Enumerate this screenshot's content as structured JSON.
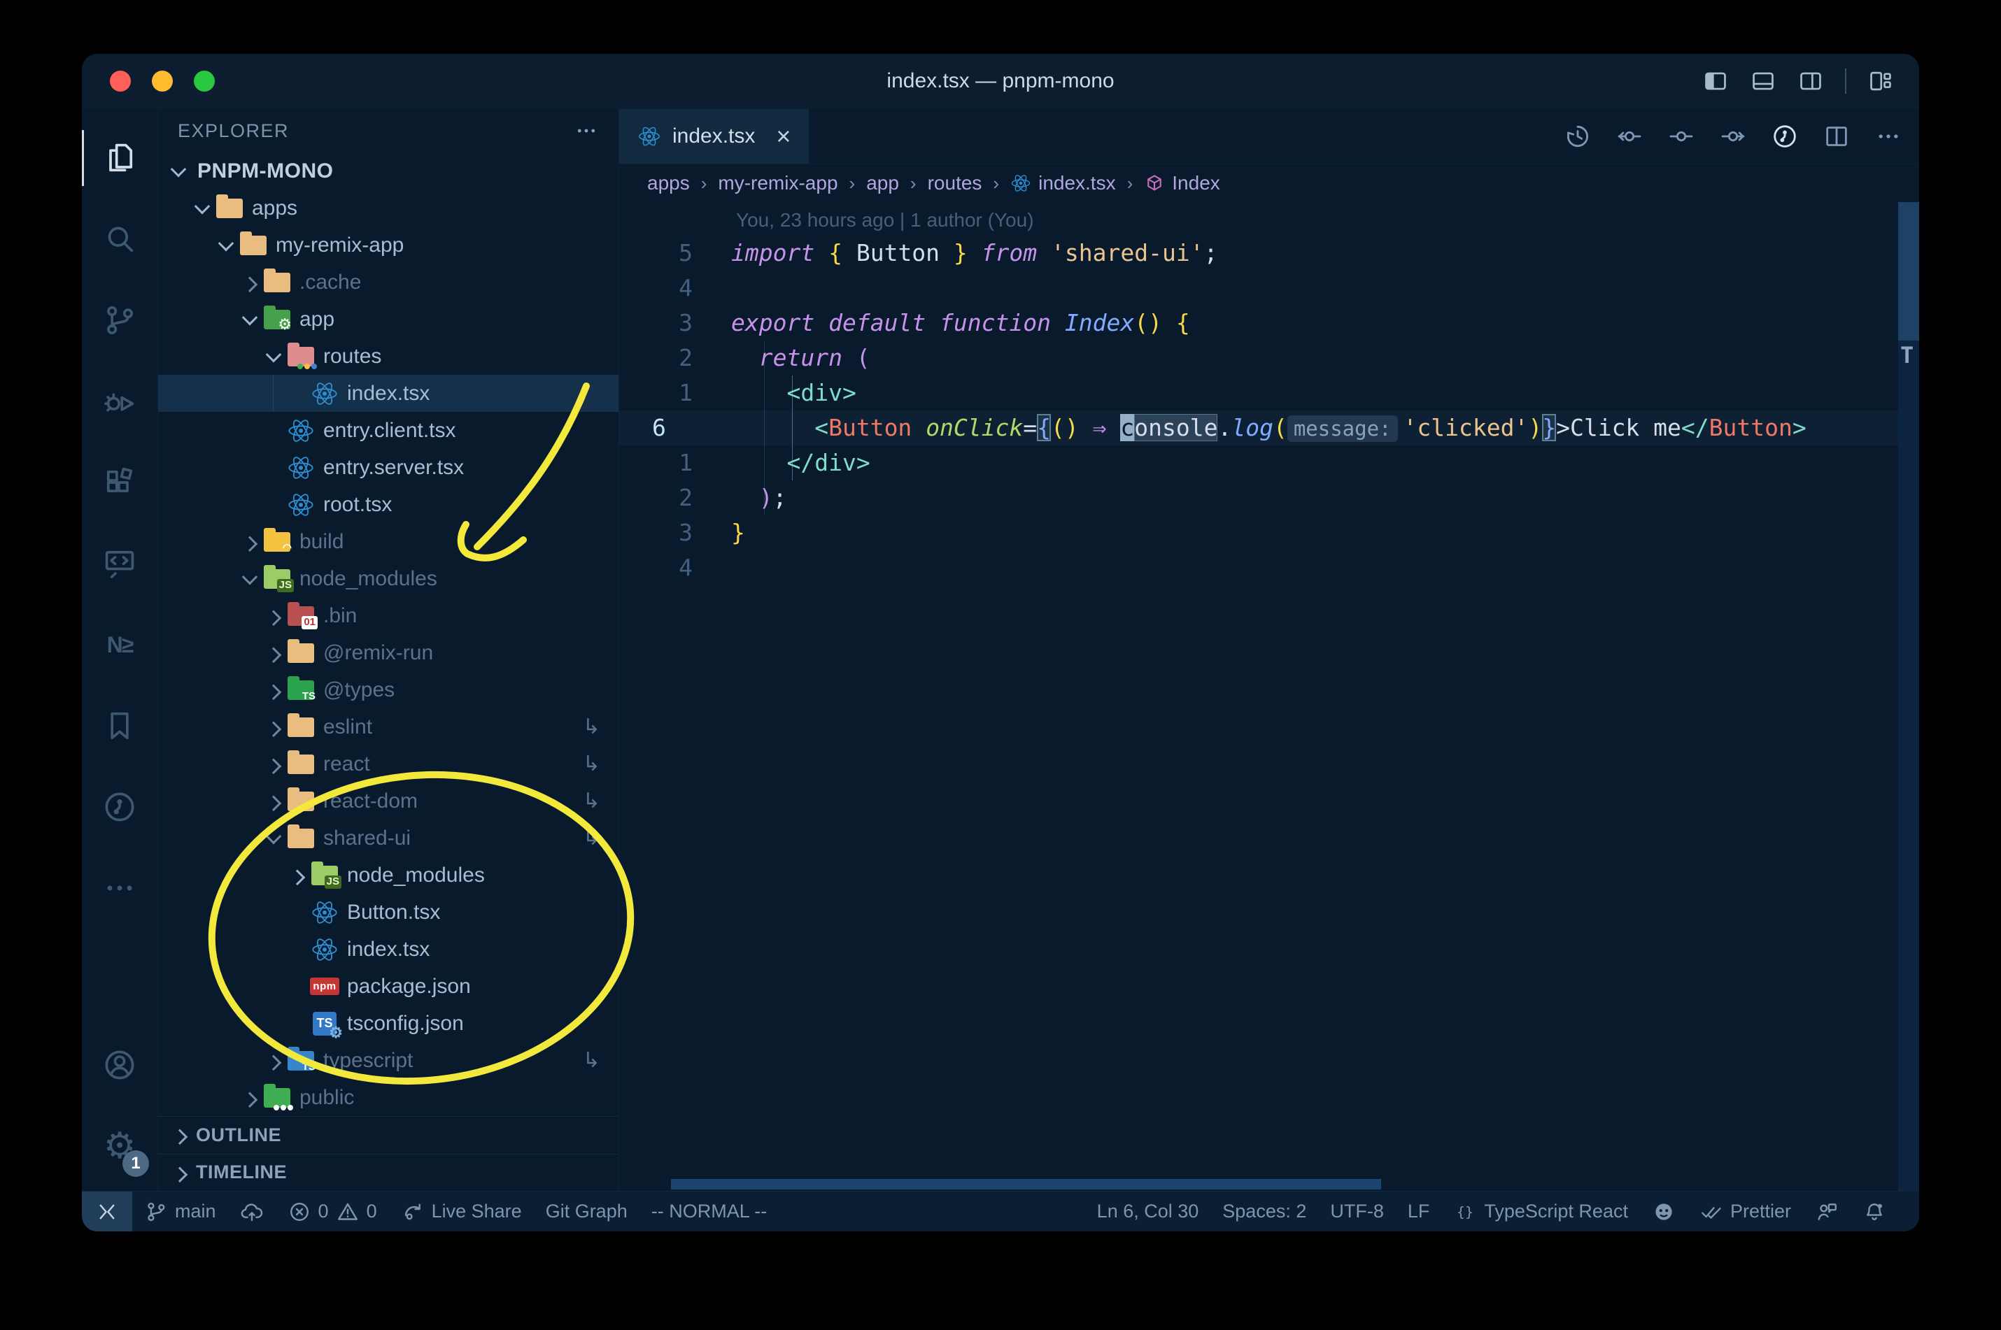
{
  "window": {
    "title": "index.tsx — pnpm-mono"
  },
  "titlebar": {
    "layout_icons": [
      {
        "name": "toggle-primary-sidebar",
        "icon": "pleft"
      },
      {
        "name": "toggle-panel",
        "icon": "pbottom"
      },
      {
        "name": "toggle-secondary-sidebar",
        "icon": "pright"
      },
      {
        "name": "customize-layout",
        "icon": "playout"
      }
    ]
  },
  "activity_bar": {
    "items": [
      {
        "name": "explorer",
        "icon": "files",
        "active": true
      },
      {
        "name": "search",
        "icon": "search"
      },
      {
        "name": "source-control",
        "icon": "branch"
      },
      {
        "name": "run-and-debug",
        "icon": "debug"
      },
      {
        "name": "extensions",
        "icon": "ext"
      },
      {
        "name": "remote-explorer",
        "icon": "remotex"
      },
      {
        "name": "nx-console",
        "icon": "nx",
        "text": "N≥"
      },
      {
        "name": "bookmarks",
        "icon": "bookmark"
      },
      {
        "name": "gitlens",
        "icon": "glens"
      },
      {
        "name": "additional-views",
        "icon": "more"
      }
    ],
    "bottom": [
      {
        "name": "accounts",
        "icon": "account"
      },
      {
        "name": "settings",
        "icon": "gear",
        "text": "⚙",
        "badge": "1"
      }
    ]
  },
  "explorer": {
    "header": "EXPLORER",
    "rows": [
      {
        "t": "PNPM-MONO",
        "l": 0,
        "c": "d",
        "i": null,
        "bold": true
      },
      {
        "t": "apps",
        "l": 1,
        "c": "d",
        "i": "tanopen"
      },
      {
        "t": "my-remix-app",
        "l": 2,
        "c": "d",
        "i": "tanopen"
      },
      {
        "t": ".cache",
        "l": 3,
        "c": "r",
        "i": "tan",
        "dim": true
      },
      {
        "t": "app",
        "l": 3,
        "c": "d",
        "i": "app"
      },
      {
        "t": "routes",
        "l": 4,
        "c": "d",
        "i": "routes"
      },
      {
        "t": "index.tsx",
        "l": 5,
        "i": "react",
        "sel": true,
        "guide": true
      },
      {
        "t": "entry.client.tsx",
        "l": 4,
        "i": "react"
      },
      {
        "t": "entry.server.tsx",
        "l": 4,
        "i": "react"
      },
      {
        "t": "root.tsx",
        "l": 4,
        "i": "react"
      },
      {
        "t": "build",
        "l": 3,
        "c": "r",
        "i": "build",
        "dim": true
      },
      {
        "t": "node_modules",
        "l": 3,
        "c": "d",
        "i": "nmopen",
        "dim": true
      },
      {
        "t": ".bin",
        "l": 4,
        "c": "r",
        "i": "bin",
        "dim": true
      },
      {
        "t": "@remix-run",
        "l": 4,
        "c": "r",
        "i": "tan",
        "dim": true
      },
      {
        "t": "@types",
        "l": 4,
        "c": "r",
        "i": "types",
        "dim": true
      },
      {
        "t": "eslint",
        "l": 4,
        "c": "r",
        "i": "tan",
        "dim": true,
        "link": true
      },
      {
        "t": "react",
        "l": 4,
        "c": "r",
        "i": "tan",
        "dim": true,
        "link": true
      },
      {
        "t": "react-dom",
        "l": 4,
        "c": "r",
        "i": "tan",
        "dim": true,
        "link": true
      },
      {
        "t": "shared-ui",
        "l": 4,
        "c": "d",
        "i": "tanopen",
        "dim": true,
        "link": true
      },
      {
        "t": "node_modules",
        "l": 5,
        "c": "r",
        "i": "nm"
      },
      {
        "t": "Button.tsx",
        "l": 5,
        "i": "react"
      },
      {
        "t": "index.tsx",
        "l": 5,
        "i": "react"
      },
      {
        "t": "package.json",
        "l": 5,
        "i": "npm"
      },
      {
        "t": "tsconfig.json",
        "l": 5,
        "i": "tsconfig"
      },
      {
        "t": "typescript",
        "l": 4,
        "c": "r",
        "i": "tsf",
        "dim": true,
        "link": true
      },
      {
        "t": "public",
        "l": 3,
        "c": "r",
        "i": "public",
        "dim": true
      }
    ],
    "link_glyph": "↳",
    "sections": [
      {
        "label": "OUTLINE"
      },
      {
        "label": "TIMELINE"
      }
    ]
  },
  "tab": {
    "label": "index.tsx",
    "icon": "react",
    "close": "×"
  },
  "editor_toolbar": [
    {
      "name": "file-history",
      "icon": "history"
    },
    {
      "name": "open-changes-previous",
      "icon": "cleft"
    },
    {
      "name": "open-changes",
      "icon": "commit"
    },
    {
      "name": "open-changes-next",
      "icon": "cright"
    },
    {
      "name": "gitlens-graph",
      "icon": "glens",
      "bright": true
    },
    {
      "name": "split-editor",
      "icon": "split"
    },
    {
      "name": "more-actions",
      "icon": "more"
    }
  ],
  "breadcrumbs": [
    {
      "label": "apps"
    },
    {
      "label": "my-remix-app"
    },
    {
      "label": "app"
    },
    {
      "label": "routes"
    },
    {
      "label": "index.tsx",
      "icon": "react"
    },
    {
      "label": "Index",
      "icon": "cube"
    }
  ],
  "breadcrumb_separator": "›",
  "editor": {
    "blame": "You, 23 hours ago | 1 author (You)",
    "lines": [
      {
        "n": "5",
        "tokens": [
          [
            "kw",
            "import"
          ],
          [
            "fg",
            " "
          ],
          [
            "gold",
            "{"
          ],
          [
            "fg",
            " Button "
          ],
          [
            "gold",
            "}"
          ],
          [
            "fg",
            " "
          ],
          [
            "kw",
            "from"
          ],
          [
            "fg",
            " "
          ],
          [
            "str",
            "'shared-ui'"
          ],
          [
            "fg",
            ";"
          ]
        ]
      },
      {
        "n": "4",
        "tokens": []
      },
      {
        "n": "3",
        "tokens": [
          [
            "kw",
            "export"
          ],
          [
            "fg",
            " "
          ],
          [
            "kw",
            "default"
          ],
          [
            "fg",
            " "
          ],
          [
            "kw",
            "function"
          ],
          [
            "fg",
            " "
          ],
          [
            "fn",
            "Index"
          ],
          [
            "gold",
            "()"
          ],
          [
            "fg",
            " "
          ],
          [
            "gold",
            "{"
          ]
        ]
      },
      {
        "n": "2",
        "tokens": [
          [
            "fg",
            "  "
          ],
          [
            "kw",
            "return"
          ],
          [
            "fg",
            " "
          ],
          [
            "pink",
            "("
          ]
        ]
      },
      {
        "n": "1",
        "tokens": [
          [
            "fg",
            "    "
          ],
          [
            "teal",
            "<div>"
          ]
        ]
      },
      {
        "n": "6",
        "cur": true,
        "tokens": [
          [
            "fg",
            "      "
          ],
          [
            "teal",
            "<"
          ],
          [
            "cmp",
            "Button"
          ],
          [
            "fg",
            " "
          ],
          [
            "attr",
            "onClick"
          ],
          [
            "fg",
            "="
          ],
          [
            "box",
            "{"
          ],
          [
            "gold",
            "()"
          ],
          [
            "fg",
            " "
          ],
          [
            "pink",
            "⇒"
          ],
          [
            "fg",
            " "
          ],
          [
            "cursor",
            "c"
          ],
          [
            "hl",
            "onsole"
          ],
          [
            "fg",
            "."
          ],
          [
            "fn",
            "log"
          ],
          [
            "gold",
            "("
          ],
          [
            "inlay",
            "message:"
          ],
          [
            "str",
            "'clicked'"
          ],
          [
            "gold",
            ")"
          ],
          [
            "box",
            "}"
          ],
          [
            "fg",
            ">Click me"
          ],
          [
            "teal",
            "</"
          ],
          [
            "cmp",
            "Button"
          ],
          [
            "teal",
            ">"
          ]
        ]
      },
      {
        "n": "1",
        "tokens": [
          [
            "fg",
            "    "
          ],
          [
            "teal",
            "</div>"
          ]
        ]
      },
      {
        "n": "2",
        "tokens": [
          [
            "fg",
            "  "
          ],
          [
            "pink",
            ")"
          ],
          [
            "fg",
            ";"
          ]
        ]
      },
      {
        "n": "3",
        "tokens": [
          [
            "gold",
            "}"
          ]
        ]
      },
      {
        "n": "4",
        "tokens": []
      }
    ]
  },
  "status_bar": {
    "left": [
      {
        "name": "remote-indicator",
        "chip": true,
        "parts": [
          {
            "icon": "remote"
          }
        ]
      },
      {
        "name": "git-branch",
        "parts": [
          {
            "icon": "branch"
          },
          {
            "text": "main"
          }
        ]
      },
      {
        "name": "publish-changes",
        "parts": [
          {
            "icon": "cloudup"
          }
        ]
      },
      {
        "name": "problems",
        "parts": [
          {
            "icon": "errorc"
          },
          {
            "text": "0"
          },
          {
            "icon": "warn"
          },
          {
            "text": "0"
          }
        ]
      },
      {
        "name": "live-share",
        "parts": [
          {
            "icon": "livesh"
          },
          {
            "text": "Live Share"
          }
        ]
      },
      {
        "name": "git-graph",
        "parts": [
          {
            "text": "Git Graph"
          }
        ]
      },
      {
        "name": "vim-mode",
        "parts": [
          {
            "text": "-- NORMAL --"
          }
        ]
      }
    ],
    "right": [
      {
        "name": "cursor-position",
        "parts": [
          {
            "text": "Ln 6, Col 30"
          }
        ]
      },
      {
        "name": "indentation",
        "parts": [
          {
            "text": "Spaces: 2"
          }
        ]
      },
      {
        "name": "encoding",
        "parts": [
          {
            "text": "UTF-8"
          }
        ]
      },
      {
        "name": "end-of-line",
        "parts": [
          {
            "text": "LF"
          }
        ]
      },
      {
        "name": "language-mode",
        "parts": [
          {
            "icon": "braces"
          },
          {
            "text": "TypeScript React"
          }
        ]
      },
      {
        "name": "github",
        "parts": [
          {
            "icon": "github"
          }
        ]
      },
      {
        "name": "prettier",
        "parts": [
          {
            "icon": "checks"
          },
          {
            "text": "Prettier"
          }
        ]
      },
      {
        "name": "feedback",
        "parts": [
          {
            "icon": "feedback"
          }
        ]
      },
      {
        "name": "notifications",
        "parts": [
          {
            "icon": "bell"
          }
        ]
      }
    ]
  },
  "annotations": {
    "color": "#f3e93c"
  }
}
